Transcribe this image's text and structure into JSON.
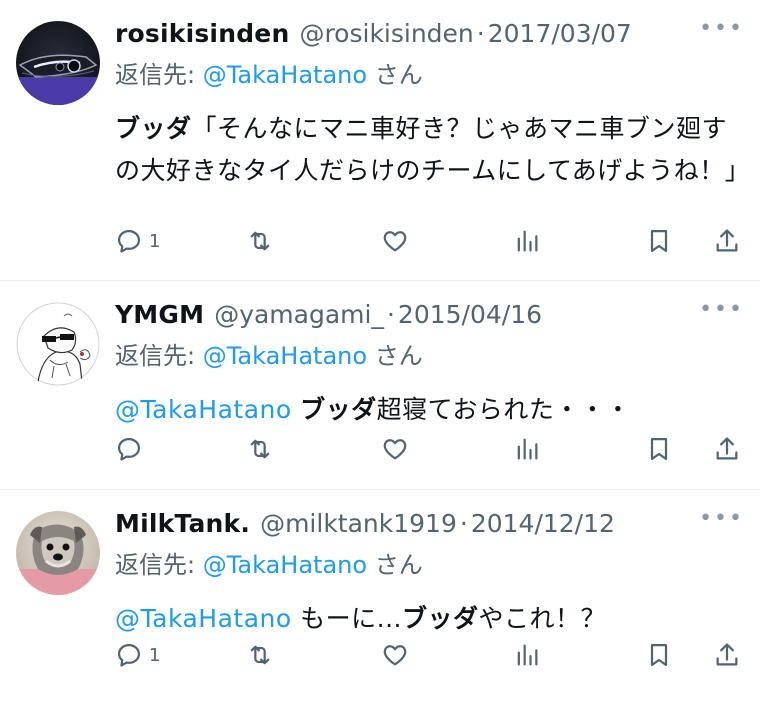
{
  "tweets": [
    {
      "name": "rosikisinden",
      "handle": "@rosikisinden",
      "separator": "·",
      "date": "2017/03/07",
      "reply_prefix": "返信先: ",
      "reply_mention": "@TakaHatano",
      "reply_suffix": " さん",
      "body_bold": "ブッダ",
      "body_text": "「そんなにマニ車好き？じゃあマニ車ブン廻すの大好きなタイ人だらけのチームにしてあげようね！」",
      "reply_count": "1",
      "avatar": "car-headlight-photo"
    },
    {
      "name": "YMGM",
      "handle": "@yamagami_",
      "separator": "·",
      "date": "2015/04/16",
      "reply_prefix": "返信先: ",
      "reply_mention": "@TakaHatano",
      "reply_suffix": " さん",
      "body_mention": "@TakaHatano",
      "body_bold": "ブッダ",
      "body_text": "超寝ておられた・・・",
      "reply_count": "",
      "avatar": "sketch-character-with-sunglasses"
    },
    {
      "name": "MilkTank.",
      "handle": "@milktank1919",
      "separator": "·",
      "date": "2014/12/12",
      "reply_prefix": "返信先: ",
      "reply_mention": "@TakaHatano",
      "reply_suffix": " さん",
      "body_mention": "@TakaHatano",
      "body_pre": " もーに...",
      "body_bold": "ブッダ",
      "body_text": "やこれ！？",
      "reply_count": "1",
      "avatar": "schnauzer-dog-photo"
    }
  ],
  "more_icon": "more-horizontal-icon",
  "colors": {
    "link": "#1d9bf0",
    "secondary_text": "#536471",
    "primary_text": "#0f1419",
    "divider": "#e8ebee"
  }
}
